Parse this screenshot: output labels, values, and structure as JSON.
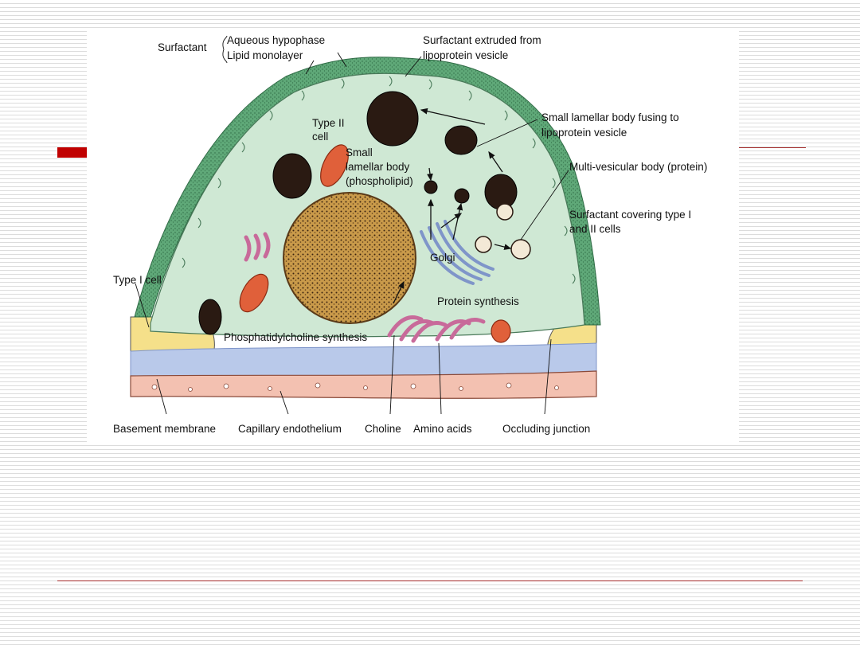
{
  "diagram": {
    "labels": {
      "surfactant": "Surfactant",
      "aqueous_hypophase": "Aqueous hypophase",
      "lipid_monolayer": "Lipid monolayer",
      "extruded_1": "Surfactant extruded from",
      "extruded_2": "lipoprotein vesicle",
      "fusing_1": "Small lamellar body fusing to",
      "fusing_2": "lipoprotein vesicle",
      "multivesicular": "Multi-vesicular body (protein)",
      "covering_1": "Surfactant covering type I",
      "covering_2": "and II cells",
      "type2_1": "Type II",
      "type2_2": "cell",
      "small_lamellar_1": "Small",
      "small_lamellar_2": "lamellar body",
      "small_lamellar_3": "(phospholipid)",
      "golgi": "Golgi",
      "protein_synthesis": "Protein synthesis",
      "type1_cell": "Type I cell",
      "pc_synthesis": "Phosphatidylcholine synthesis",
      "basement_membrane": "Basement membrane",
      "capillary_endothelium": "Capillary endothelium",
      "choline": "Choline",
      "amino_acids": "Amino acids",
      "occluding_junction": "Occluding junction"
    },
    "colors": {
      "surfactant_layer": "#5fa878",
      "cytoplasm": "#cfe8d4",
      "nucleus": "#c99a4a",
      "lamellar_body": "#2a1a12",
      "mitochondria": "#e0603a",
      "er": "#c86a9a",
      "golgi": "#7f95c9",
      "type1_cell": "#f5e08a",
      "basement": "#b9c9ea",
      "endothelium": "#f3c1b1"
    }
  }
}
